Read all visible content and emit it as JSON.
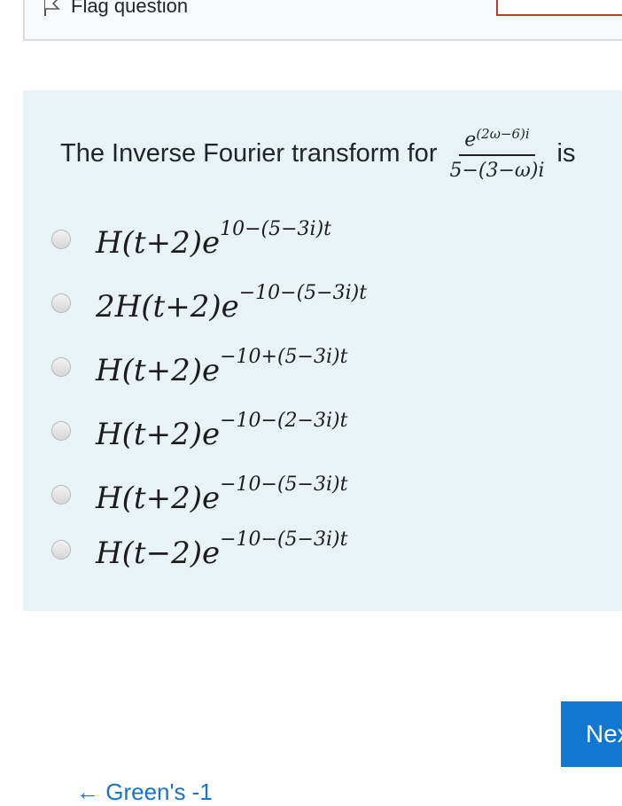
{
  "flag": {
    "label": "Flag question"
  },
  "question": {
    "prefix": "The Inverse Fourier transform for",
    "numerator_base": "e",
    "numerator_exp": "(2ω−6)i",
    "denominator": "5−(3−ω)i",
    "suffix": "is"
  },
  "options": [
    {
      "base": "H(t+2)e",
      "exp": "10−(5−3i)t"
    },
    {
      "base": "2H(t+2)e",
      "exp": "−10−(5−3i)t"
    },
    {
      "base": "H(t+2)e",
      "exp": "−10+(5−3i)t"
    },
    {
      "base": "H(t+2)e",
      "exp": "−10−(2−3i)t"
    },
    {
      "base": "H(t+2)e",
      "exp": "−10−(5−3i)t"
    },
    {
      "base": "H(t−2)e",
      "exp": "−10−(5−3i)t"
    }
  ],
  "nav": {
    "next_label": "Next",
    "prev_label": "← Green's -1"
  }
}
